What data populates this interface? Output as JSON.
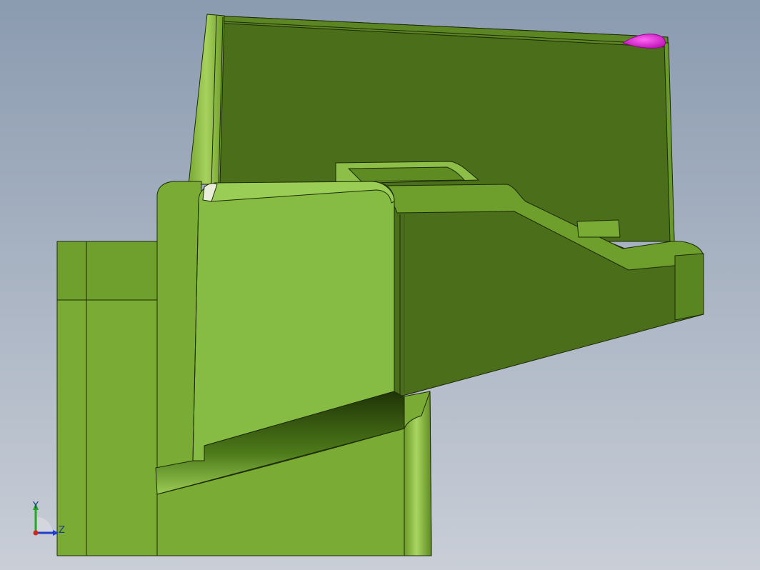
{
  "viewport": {
    "background_top": "#8b9bb0",
    "background_bottom": "#c9ced7"
  },
  "model": {
    "colors": {
      "base_dark": "#4a6e1a",
      "base_mid": "#7aab34",
      "base_light": "#86bb44",
      "face_light": "#8ec04a",
      "shadow": "#2f4a0c",
      "edge": "#1c2a06",
      "highlight": "#ff33ee",
      "highlight_dark": "#b012b0"
    }
  },
  "triad": {
    "y_label": "Y",
    "z_label": "Z",
    "y_color": "#22aa22",
    "z_color": "#1e3cc8",
    "x_color": "#d0241c",
    "backplate": "#d3d6dc"
  }
}
